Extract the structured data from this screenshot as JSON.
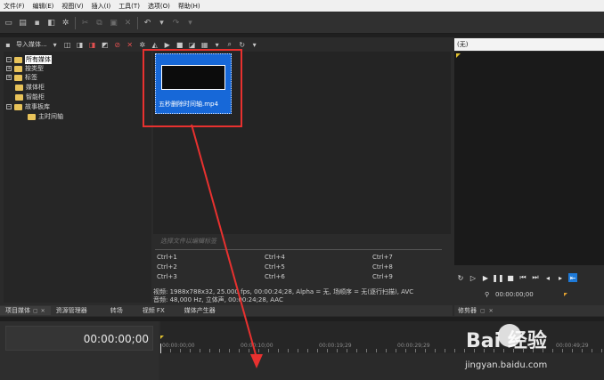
{
  "menubar": [
    "文件(F)",
    "编辑(E)",
    "视图(V)",
    "插入(I)",
    "工具(T)",
    "选项(O)",
    "帮助(H)"
  ],
  "media_toolbar": {
    "import_label": "导入媒体..."
  },
  "tree": [
    {
      "label": "所有媒体",
      "selected": true
    },
    {
      "label": "按类型"
    },
    {
      "label": "标签"
    },
    {
      "label": "媒体柜"
    },
    {
      "label": "智能柜"
    },
    {
      "label": "故事板库"
    },
    {
      "label": "主时间轴"
    }
  ],
  "media_item": {
    "filename": "五秒删除时间轴.mp4"
  },
  "select_hint": "选择文件以编辑标签",
  "shortcuts": [
    "Ctrl+1",
    "Ctrl+4",
    "Ctrl+7",
    "Ctrl+2",
    "Ctrl+5",
    "Ctrl+8",
    "Ctrl+3",
    "Ctrl+6",
    "Ctrl+9"
  ],
  "info": {
    "video": "视频: 1988x788x32, 25.000 fps, 00:00:24;28, Alpha = 无, 场顺序 = 无(逐行扫描), AVC",
    "audio": "音频: 48,000 Hz, 立体声, 00:00:24;28, AAC"
  },
  "left_tabs": [
    "项目媒体",
    "资源管理器",
    "转场",
    "视频 FX",
    "媒体产生器"
  ],
  "preview": {
    "title": "(无)",
    "time": "00:00:00;00"
  },
  "right_tabs": [
    "修剪器"
  ],
  "timeline": {
    "timecode": "00:00:00;00",
    "marks": [
      "00:00:00;00",
      "00:00:10;00",
      "00:00:19;29",
      "00:00:29;29",
      "00:00:49;29"
    ]
  },
  "watermark": {
    "brand": "Bai 经验",
    "url": "jingyan.baidu.com"
  },
  "colors": {
    "selection_blue": "#1768d8",
    "highlight_red": "#e8312f",
    "marker_yellow": "#e0c030"
  }
}
